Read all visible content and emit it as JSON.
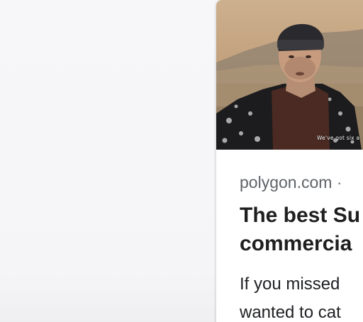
{
  "article_card": {
    "thumbnail": {
      "alt_icon": "video-thumbnail-image",
      "overlay_caption": "We've got six a"
    },
    "source": "polygon.com",
    "separator": "·",
    "title_lines": [
      "The best Su",
      "commercia"
    ],
    "snippet_lines": [
      "If you missed",
      "wanted to cat"
    ]
  }
}
